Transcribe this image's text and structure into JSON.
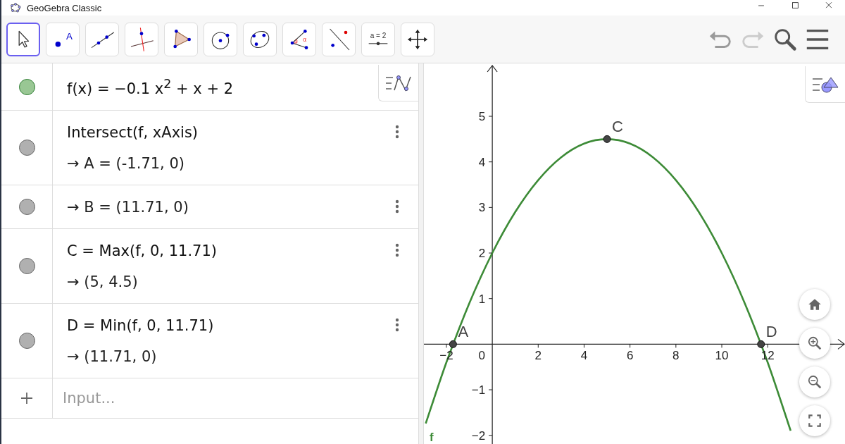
{
  "window": {
    "title": "GeoGebra Classic"
  },
  "toolbar": {
    "tools": [
      {
        "kind": "move",
        "selected": true
      },
      {
        "kind": "point",
        "label": "A",
        "selected": false
      },
      {
        "kind": "line",
        "selected": false
      },
      {
        "kind": "perpendicular",
        "selected": false
      },
      {
        "kind": "polygon",
        "selected": false
      },
      {
        "kind": "circle",
        "selected": false
      },
      {
        "kind": "conic",
        "selected": false
      },
      {
        "kind": "angle",
        "label": "α",
        "selected": false
      },
      {
        "kind": "reflect",
        "selected": false
      },
      {
        "kind": "slider",
        "label": "a = 2",
        "selected": false
      },
      {
        "kind": "move-view",
        "selected": false
      }
    ],
    "undo": {
      "disabled": false
    },
    "redo": {
      "disabled": true
    }
  },
  "algebra": {
    "items": [
      {
        "color": "#99c794",
        "definition": "f(x) = −0.1 x$^{2}$ + x + 2"
      },
      {
        "color": "#b0b0b0",
        "definition": "Intersect(f, xAxis)",
        "output": "→ A = (-1.71, 0)",
        "menu": true
      },
      {
        "color": "#b0b0b0",
        "output": "→ B = (11.71, 0)",
        "menu": true
      },
      {
        "color": "#b0b0b0",
        "definition": "C = Max(f, 0, 11.71)",
        "output": "→ (5, 4.5)",
        "menu": true
      },
      {
        "color": "#b0b0b0",
        "definition": "D = Min(f, 0, 11.71)",
        "output": "→ (11.71, 0)",
        "menu": true
      }
    ],
    "input": {
      "placeholder": "Input..."
    }
  },
  "graphics": {
    "chart_data": {
      "type": "line",
      "x": [
        -2.9,
        -2,
        -1,
        0,
        1,
        2,
        3,
        4,
        5,
        6,
        7,
        8,
        9,
        10,
        11,
        12,
        13
      ],
      "series": [
        {
          "name": "f",
          "color": "#3d8b37",
          "values": [
            -1.74,
            -0.4,
            0.9,
            2,
            2.9,
            3.6,
            4.1,
            4.4,
            4.5,
            4.4,
            4.1,
            3.6,
            2.9,
            2,
            0.9,
            -0.4,
            -1.9
          ]
        }
      ],
      "xlim": [
        -2.98,
        15.43
      ],
      "ylim": [
        -2.19,
        6.16
      ],
      "xticks": [
        {
          "value": -2,
          "label": "−2"
        },
        2,
        4,
        6,
        8,
        10,
        12
      ],
      "yticks": [
        {
          "value": -2,
          "label": "−2"
        },
        {
          "value": -1,
          "label": "−1"
        },
        1,
        2,
        3,
        4,
        5
      ],
      "annotations": [
        {
          "x": -1.71,
          "y": 0,
          "text": "A"
        },
        {
          "x": 5,
          "y": 4.5,
          "text": "C"
        },
        {
          "x": 11.71,
          "y": 0,
          "text": "D"
        }
      ]
    },
    "origin_label": "0"
  }
}
